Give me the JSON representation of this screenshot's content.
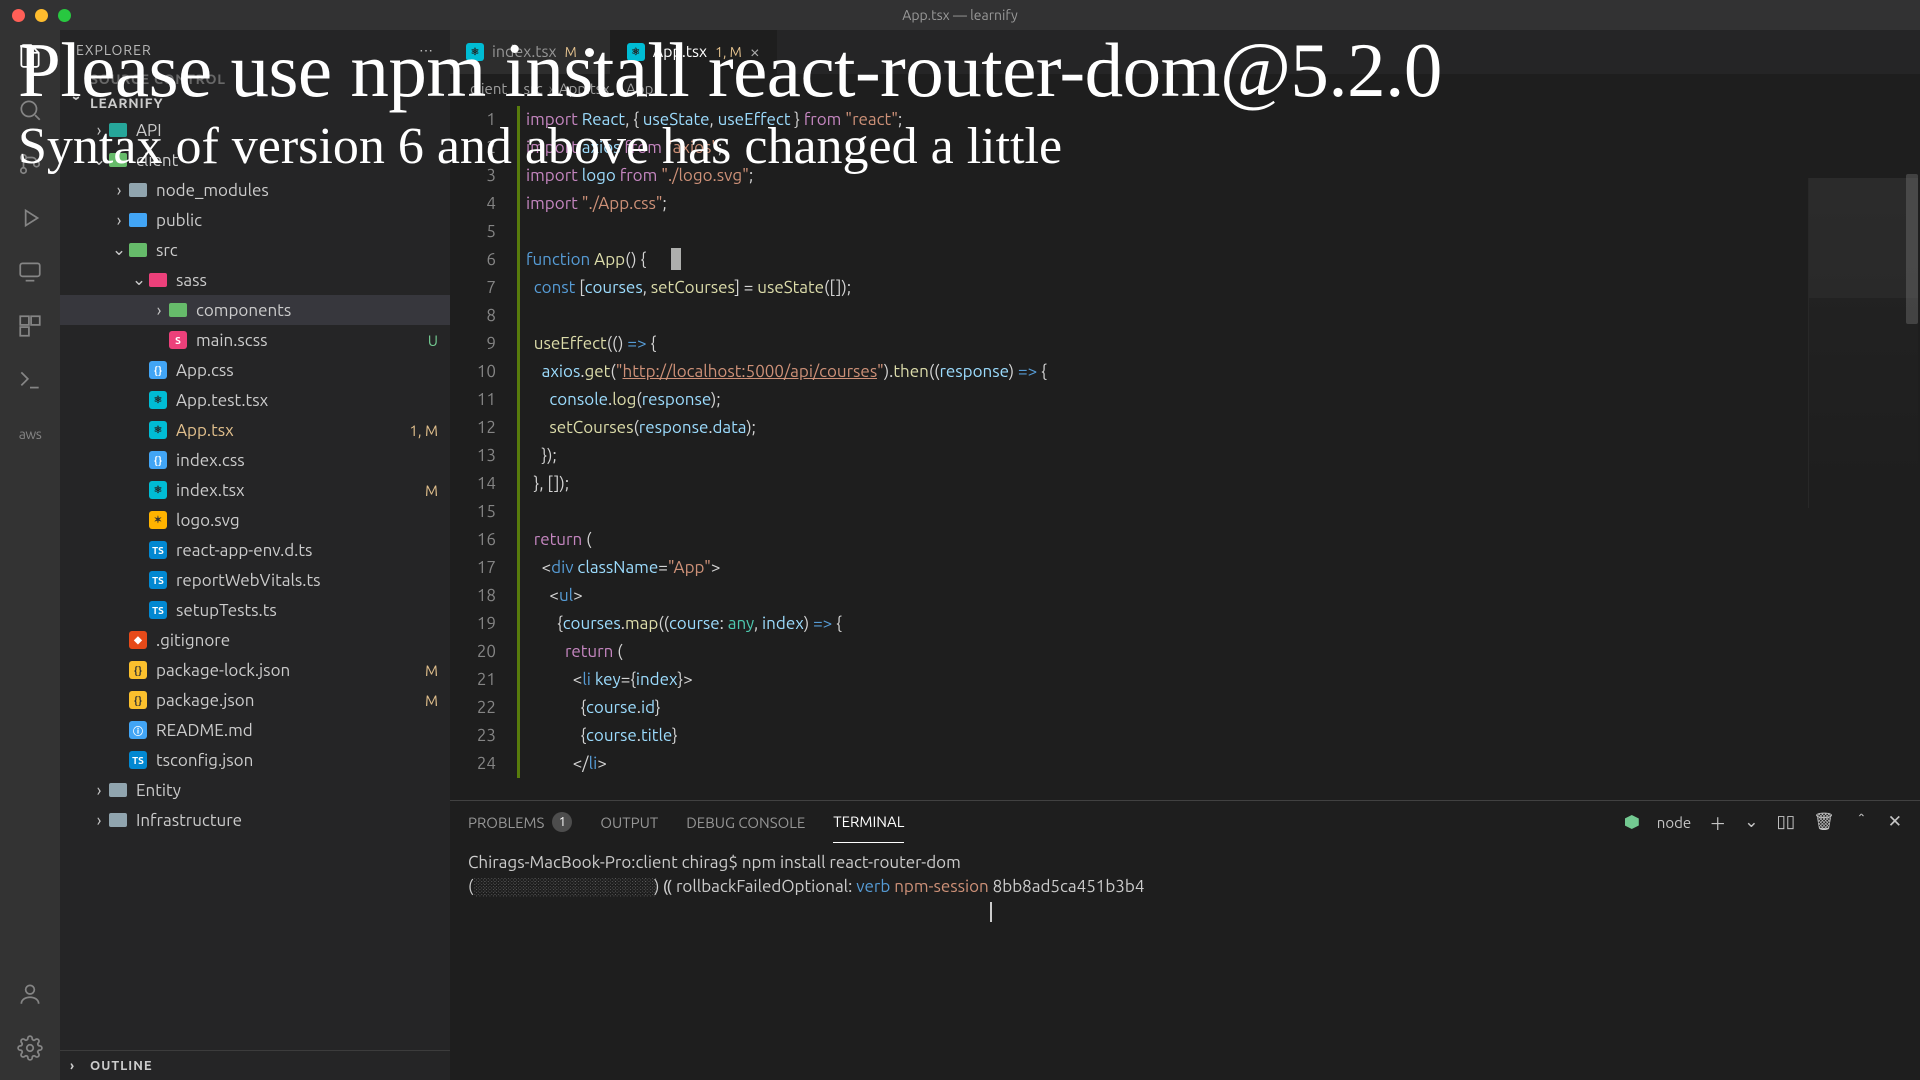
{
  "window_title": "App.tsx — learnify",
  "overlay": {
    "line1": "Please use npm install react-router-dom@5.2.0",
    "line2": "Syntax of version 6 and above has changed a little"
  },
  "sidebar": {
    "header": "EXPLORER",
    "source_control_label": "SOURCE CONTROL",
    "project": "LEARNIFY",
    "outline": "OUTLINE",
    "tree": [
      {
        "depth": 1,
        "kind": "folder",
        "label": "API",
        "open": false,
        "color": "teal"
      },
      {
        "depth": 1,
        "kind": "folder",
        "label": "client",
        "open": true,
        "color": "green",
        "status_dot": true
      },
      {
        "depth": 2,
        "kind": "folder",
        "label": "node_modules",
        "open": false,
        "color": "grey"
      },
      {
        "depth": 2,
        "kind": "folder",
        "label": "public",
        "open": false,
        "color": "blue",
        "status_dot": true
      },
      {
        "depth": 2,
        "kind": "folder",
        "label": "src",
        "open": true,
        "color": "green",
        "status_dot": true
      },
      {
        "depth": 3,
        "kind": "folder",
        "label": "sass",
        "open": true,
        "color": "pink",
        "status_dot": true
      },
      {
        "depth": 4,
        "kind": "folder",
        "label": "components",
        "open": false,
        "color": "green",
        "selected": true
      },
      {
        "depth": 4,
        "kind": "file",
        "icon": "sass",
        "label": "main.scss",
        "status": "U"
      },
      {
        "depth": 3,
        "kind": "file",
        "icon": "css",
        "label": "App.css"
      },
      {
        "depth": 3,
        "kind": "file",
        "icon": "react",
        "label": "App.test.tsx"
      },
      {
        "depth": 3,
        "kind": "file",
        "icon": "react",
        "label": "App.tsx",
        "status": "1, M",
        "active": true
      },
      {
        "depth": 3,
        "kind": "file",
        "icon": "css",
        "label": "index.css"
      },
      {
        "depth": 3,
        "kind": "file",
        "icon": "react",
        "label": "index.tsx",
        "status": "M"
      },
      {
        "depth": 3,
        "kind": "file",
        "icon": "svg",
        "label": "logo.svg"
      },
      {
        "depth": 3,
        "kind": "file",
        "icon": "ts",
        "label": "react-app-env.d.ts"
      },
      {
        "depth": 3,
        "kind": "file",
        "icon": "ts",
        "label": "reportWebVitals.ts"
      },
      {
        "depth": 3,
        "kind": "file",
        "icon": "ts",
        "label": "setupTests.ts"
      },
      {
        "depth": 2,
        "kind": "file",
        "icon": "git",
        "label": ".gitignore"
      },
      {
        "depth": 2,
        "kind": "file",
        "icon": "json",
        "label": "package-lock.json",
        "status": "M"
      },
      {
        "depth": 2,
        "kind": "file",
        "icon": "json",
        "label": "package.json",
        "status": "M"
      },
      {
        "depth": 2,
        "kind": "file",
        "icon": "md",
        "label": "README.md"
      },
      {
        "depth": 2,
        "kind": "file",
        "icon": "ts",
        "label": "tsconfig.json"
      },
      {
        "depth": 1,
        "kind": "folder",
        "label": "Entity",
        "open": false,
        "color": "grey"
      },
      {
        "depth": 1,
        "kind": "folder",
        "label": "Infrastructure",
        "open": false,
        "color": "grey"
      }
    ]
  },
  "tabs": [
    {
      "icon": "react",
      "label": "index.tsx",
      "modified": true,
      "status": "M",
      "active": false
    },
    {
      "icon": "react",
      "label": "App.tsx",
      "modified": true,
      "status": "1, M",
      "active": true
    }
  ],
  "breadcrumbs": [
    "client",
    "src",
    "App.tsx",
    "App"
  ],
  "code": {
    "lines": [
      {
        "n": 1,
        "bar": "mod",
        "html": "<span class='kw2'>import</span> <span class='id'>React</span><span class='pn'>, { </span><span class='id'>useState</span><span class='pn'>, </span><span class='id'>useEffect</span><span class='pn'> } </span><span class='kw2'>from</span> <span class='str'>\"react\"</span><span class='pn'>;</span>"
      },
      {
        "n": 2,
        "bar": "mod",
        "html": "<span class='kw2'>import</span> <span class='id'>axios</span> <span class='kw2'>from</span> <span class='str'>\"axios\"</span><span class='pn'>;</span>"
      },
      {
        "n": 3,
        "bar": "mod",
        "html": "<span class='kw2'>import</span> <span class='id'>logo</span> <span class='kw2'>from</span> <span class='str'>\"./logo.svg\"</span><span class='pn'>;</span>"
      },
      {
        "n": 4,
        "bar": "mod",
        "html": "<span class='kw2'>import</span> <span class='str'>\"./App.css\"</span><span class='pn'>;</span>"
      },
      {
        "n": 5,
        "bar": "mod",
        "html": ""
      },
      {
        "n": 6,
        "bar": "mod",
        "html": "<span class='kw'>function</span> <span class='fn'>App</span><span class='pn'>() {</span>"
      },
      {
        "n": 7,
        "bar": "mod",
        "html": "  <span class='kw'>const</span> <span class='pn'>[</span><span class='id'>courses</span><span class='pn'>, </span><span class='fn'>setCourses</span><span class='pn'>] = </span><span class='fn'>useState</span><span class='pn'>([]);</span>"
      },
      {
        "n": 8,
        "bar": "mod",
        "html": ""
      },
      {
        "n": 9,
        "bar": "mod",
        "html": "  <span class='fn'>useEffect</span><span class='pn'>(</span><span class='pn'>() </span><span class='kw'>=&gt;</span><span class='pn'> {</span>"
      },
      {
        "n": 10,
        "bar": "mod",
        "html": "    <span class='id'>axios</span><span class='pn'>.</span><span class='fn'>get</span><span class='pn'>(</span><span class='str'>\"</span><span class='url'>http://localhost:5000/api/courses</span><span class='str'>\"</span><span class='pn'>).</span><span class='fn'>then</span><span class='pn'>((</span><span class='param'>response</span><span class='pn'>) </span><span class='kw'>=&gt;</span><span class='pn'> {</span>"
      },
      {
        "n": 11,
        "bar": "mod",
        "html": "      <span class='id'>console</span><span class='pn'>.</span><span class='fn'>log</span><span class='pn'>(</span><span class='id'>response</span><span class='pn'>);</span>"
      },
      {
        "n": 12,
        "bar": "mod",
        "html": "      <span class='fn'>setCourses</span><span class='pn'>(</span><span class='id'>response</span><span class='pn'>.</span><span class='id'>data</span><span class='pn'>);</span>"
      },
      {
        "n": 13,
        "bar": "mod",
        "html": "    <span class='pn'>});</span>"
      },
      {
        "n": 14,
        "bar": "mod",
        "html": "  <span class='pn'>}, []);</span>"
      },
      {
        "n": 15,
        "bar": "mod",
        "html": ""
      },
      {
        "n": 16,
        "bar": "mod",
        "html": "  <span class='kw2'>return</span> <span class='pn'>(</span>"
      },
      {
        "n": 17,
        "bar": "mod",
        "html": "    <span class='pn'>&lt;</span><span class='kw'>div</span> <span class='id'>className</span><span class='pn'>=</span><span class='str'>\"App\"</span><span class='pn'>&gt;</span>"
      },
      {
        "n": 18,
        "bar": "mod",
        "html": "      <span class='pn'>&lt;</span><span class='kw'>ul</span><span class='pn'>&gt;</span>"
      },
      {
        "n": 19,
        "bar": "mod",
        "html": "        <span class='pn'>{</span><span class='id'>courses</span><span class='pn'>.</span><span class='fn'>map</span><span class='pn'>((</span><span class='param'>course</span><span class='pn'>: </span><span class='typ'>any</span><span class='pn'>, </span><span class='param'>index</span><span class='pn'>) </span><span class='kw'>=&gt;</span><span class='pn'> {</span>"
      },
      {
        "n": 20,
        "bar": "mod",
        "html": "          <span class='kw2'>return</span> <span class='pn'>(</span>"
      },
      {
        "n": 21,
        "bar": "mod",
        "html": "            <span class='pn'>&lt;</span><span class='kw'>li</span> <span class='id'>key</span><span class='pn'>={</span><span class='id'>index</span><span class='pn'>}&gt;</span>"
      },
      {
        "n": 22,
        "bar": "mod",
        "html": "              <span class='pn'>{</span><span class='id'>course</span><span class='pn'>.</span><span class='id'>id</span><span class='pn'>}</span>"
      },
      {
        "n": 23,
        "bar": "mod",
        "html": "              <span class='pn'>{</span><span class='id'>course</span><span class='pn'>.</span><span class='id'>title</span><span class='pn'>}</span>"
      },
      {
        "n": 24,
        "bar": "mod",
        "html": "            <span class='pn'>&lt;/</span><span class='kw'>li</span><span class='pn'>&gt;</span>"
      }
    ]
  },
  "panel": {
    "tabs": {
      "problems": "PROBLEMS",
      "problems_count": "1",
      "output": "OUTPUT",
      "debug": "DEBUG CONSOLE",
      "terminal": "TERMINAL"
    },
    "shell_label": "node",
    "term": {
      "prompt": "Chirags-MacBook-Pro:client chirag$ ",
      "cmd": "npm install react-router-dom",
      "line2_pre": "(",
      "spinner": "░░░░░░░░░░░░░░░░░░",
      "line2_post": ") ⸨ rollbackFailedOptional: ",
      "verb": "verb",
      "sess": "npm-session",
      "hash": "8bb8ad5ca451b3b4"
    }
  }
}
